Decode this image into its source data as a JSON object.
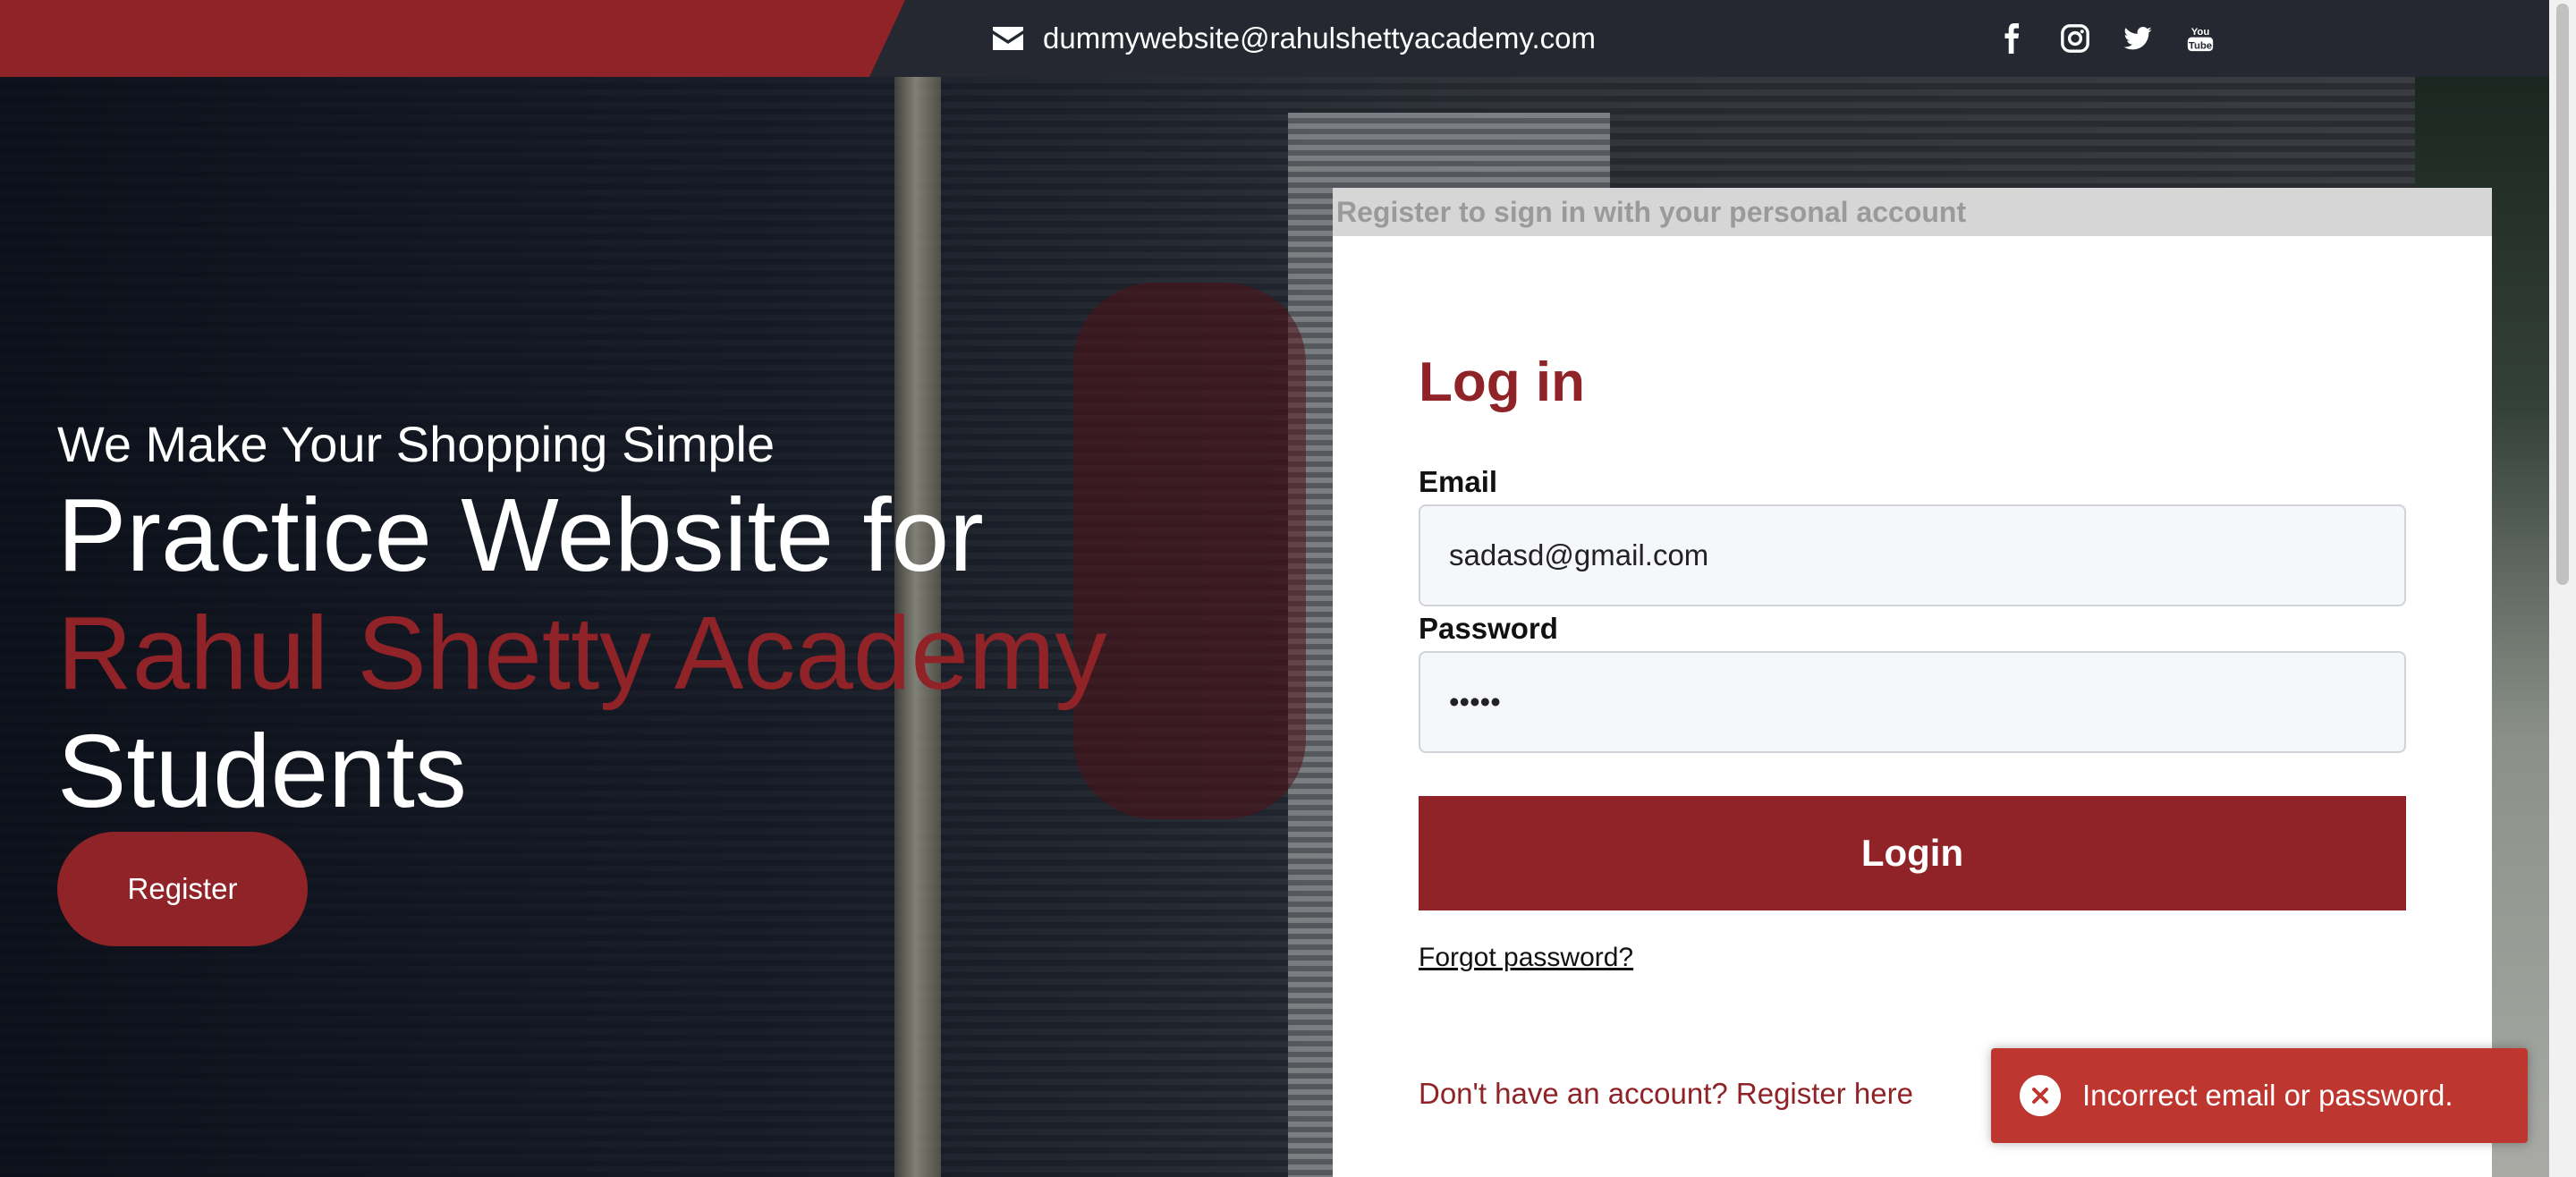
{
  "topbar": {
    "email": "dummywebsite@rahulshettyacademy.com",
    "email_icon": "envelope-icon",
    "socials": [
      "facebook-icon",
      "instagram-icon",
      "twitter-icon",
      "youtube-icon"
    ]
  },
  "hero": {
    "tagline": "We Make Your Shopping Simple",
    "headline_line1": "Practice Website for",
    "headline_line2": "Rahul Shetty Academy",
    "headline_line3": "Students",
    "register_label": "Register"
  },
  "login": {
    "banner": "Register to sign in with your personal account",
    "title": "Log in",
    "email_label": "Email",
    "email_value": "sadasd@gmail.com",
    "password_label": "Password",
    "password_value": "•••••",
    "login_button": "Login",
    "forgot": "Forgot password?",
    "signup": "Don't have an account? Register here"
  },
  "toast": {
    "message": "Incorrect email or password.",
    "icon": "error-x-icon"
  },
  "colors": {
    "accent": "#8f2327",
    "topbar": "#252830",
    "toast": "#bd362f"
  }
}
